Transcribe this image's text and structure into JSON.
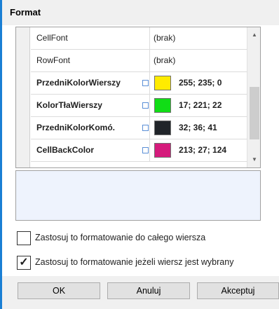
{
  "title": "Format",
  "properties": [
    {
      "name": "CellFont",
      "value": "(brak)",
      "bold": false,
      "editor": false,
      "color": null
    },
    {
      "name": "RowFont",
      "value": "(brak)",
      "bold": false,
      "editor": false,
      "color": null
    },
    {
      "name": "PrzedniKolorWierszy",
      "value": "255; 235; 0",
      "bold": true,
      "editor": true,
      "color": "#ffeb00"
    },
    {
      "name": "KolorTłaWierszy",
      "value": "17; 221; 22",
      "bold": true,
      "editor": true,
      "color": "#11dd16"
    },
    {
      "name": "PrzedniKolorKomó.",
      "value": "32; 36; 41",
      "bold": true,
      "editor": true,
      "color": "#202429"
    },
    {
      "name": "CellBackColor",
      "value": "213; 27; 124",
      "bold": true,
      "editor": true,
      "color": "#d51b7c"
    }
  ],
  "checkboxes": [
    {
      "label": "Zastosuj to formatowanie do całego wiersza",
      "checked": false
    },
    {
      "label": "Zastosuj to formatowanie jeżeli wiersz jest wybrany",
      "checked": true
    }
  ],
  "buttons": {
    "ok": "OK",
    "cancel": "Anuluj",
    "apply": "Akceptuj"
  },
  "accent_color": "#1a7fd4"
}
